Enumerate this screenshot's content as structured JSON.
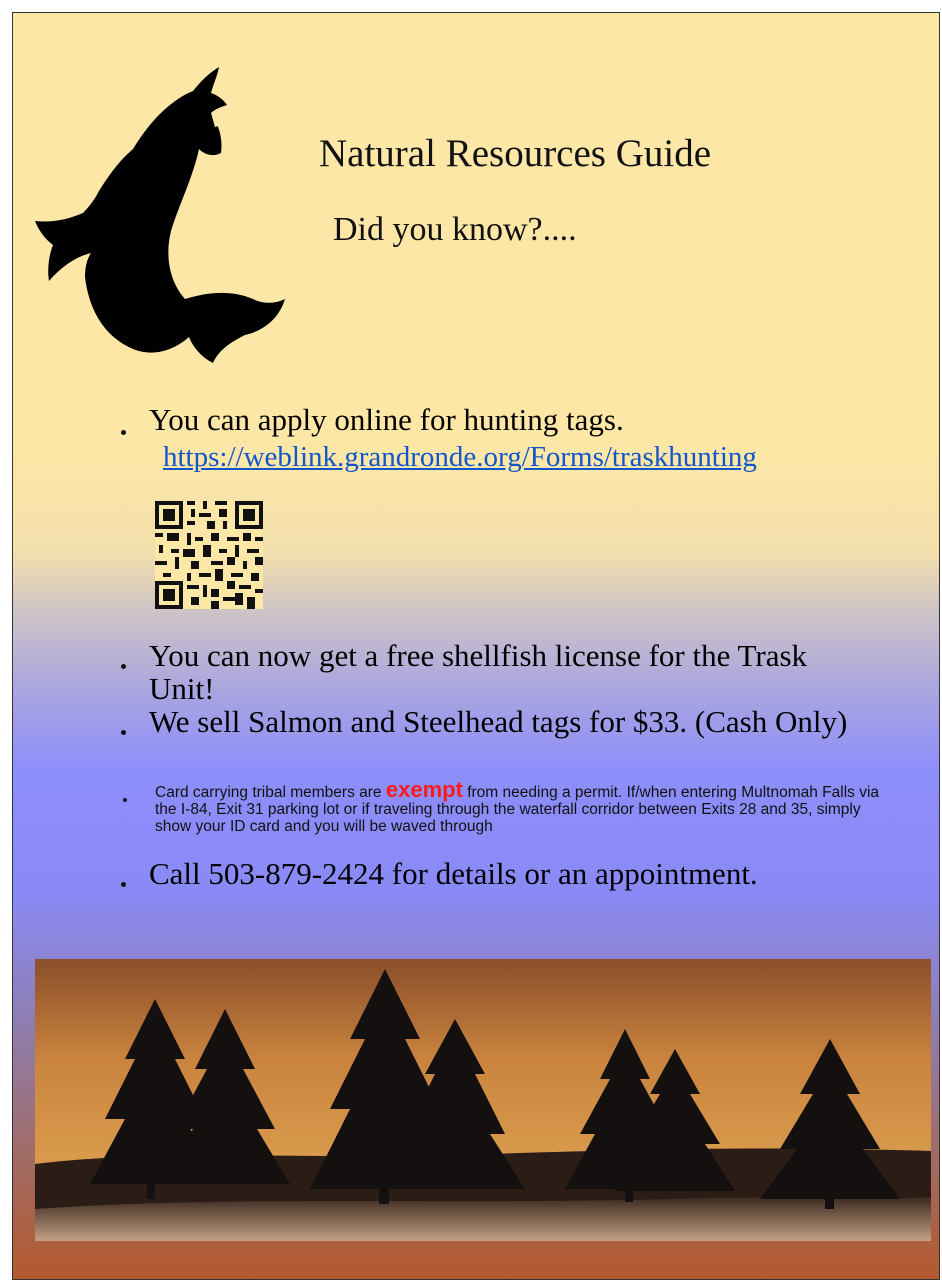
{
  "header": {
    "title": "Natural Resources Guide",
    "subtitle": "Did you know?...."
  },
  "bullets": [
    {
      "text": "You  can apply online for  hunting tags."
    },
    {
      "text": "You can now get a free shellfish license for the Trask Unit!"
    },
    {
      "text": "We sell Salmon and Steelhead tags for $33. (Cash Only)"
    },
    {
      "pre": "Card carrying tribal members are ",
      "highlight": "exempt",
      "post": " from needing a permit. If/when entering Multnomah Falls via the I-84, Exit 31 parking lot or if traveling through the waterfall corridor between Exits 28 and 35, simply show your ID card and you will be waved through"
    },
    {
      "text": "Call 503-879-2424 for details or an appointment."
    }
  ],
  "link": {
    "text": "https://weblink.grandronde.org/Forms/traskhunting"
  },
  "icons": {
    "fish": "jumping-salmon-silhouette-icon",
    "qr": "qr-code-icon"
  },
  "colors": {
    "link": "#1155cc",
    "exempt": "#ff1a1a"
  }
}
